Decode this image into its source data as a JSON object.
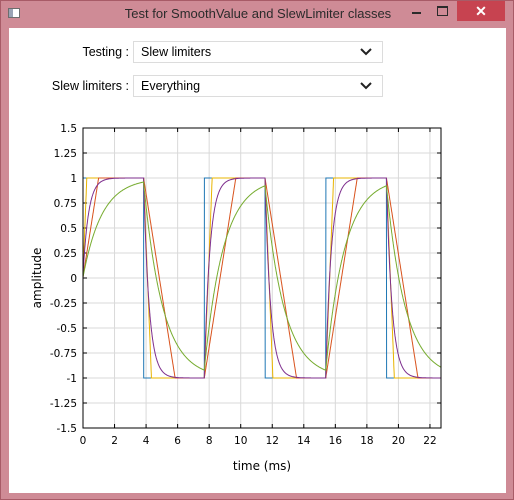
{
  "window": {
    "title": "Test for SmoothValue and SlewLimiter classes",
    "close_glyph": "✕"
  },
  "controls": {
    "testing_label": "Testing :",
    "testing_value": "Slew limiters",
    "slew_label": "Slew limiters :",
    "slew_value": "Everything"
  },
  "chart_data": {
    "type": "line",
    "xlabel": "time (ms)",
    "ylabel": "amplitude",
    "xlim": [
      0,
      22.7
    ],
    "ylim": [
      -1.5,
      1.5
    ],
    "xticks": [
      "0",
      "2",
      "4",
      "6",
      "8",
      "10",
      "12",
      "14",
      "16",
      "18",
      "20",
      "22"
    ],
    "yticks": [
      "1.5",
      "1.25",
      "1",
      "0.75",
      "0.5",
      "0.25",
      "0",
      "-0.25",
      "-0.5",
      "-0.75",
      "-1",
      "-1.25",
      "-1.5"
    ],
    "grid": true,
    "series": [
      {
        "color": "#1f77b4",
        "kind": "square",
        "delay": 0.0,
        "param": 0
      },
      {
        "color": "#e8b400",
        "kind": "slew",
        "delay": 0.0,
        "param": 0.5
      },
      {
        "color": "#d9541f",
        "kind": "slew",
        "delay": 0.0,
        "param": 2.0
      },
      {
        "color": "#7e2f8e",
        "kind": "exp",
        "delay": 0.0,
        "param": 0.35
      },
      {
        "color": "#77ac30",
        "kind": "exp",
        "delay": 0.0,
        "param": 1.2
      }
    ],
    "square": {
      "period": 7.7,
      "high_start": 0.0,
      "high_end": 3.85,
      "start_level": 0
    }
  }
}
